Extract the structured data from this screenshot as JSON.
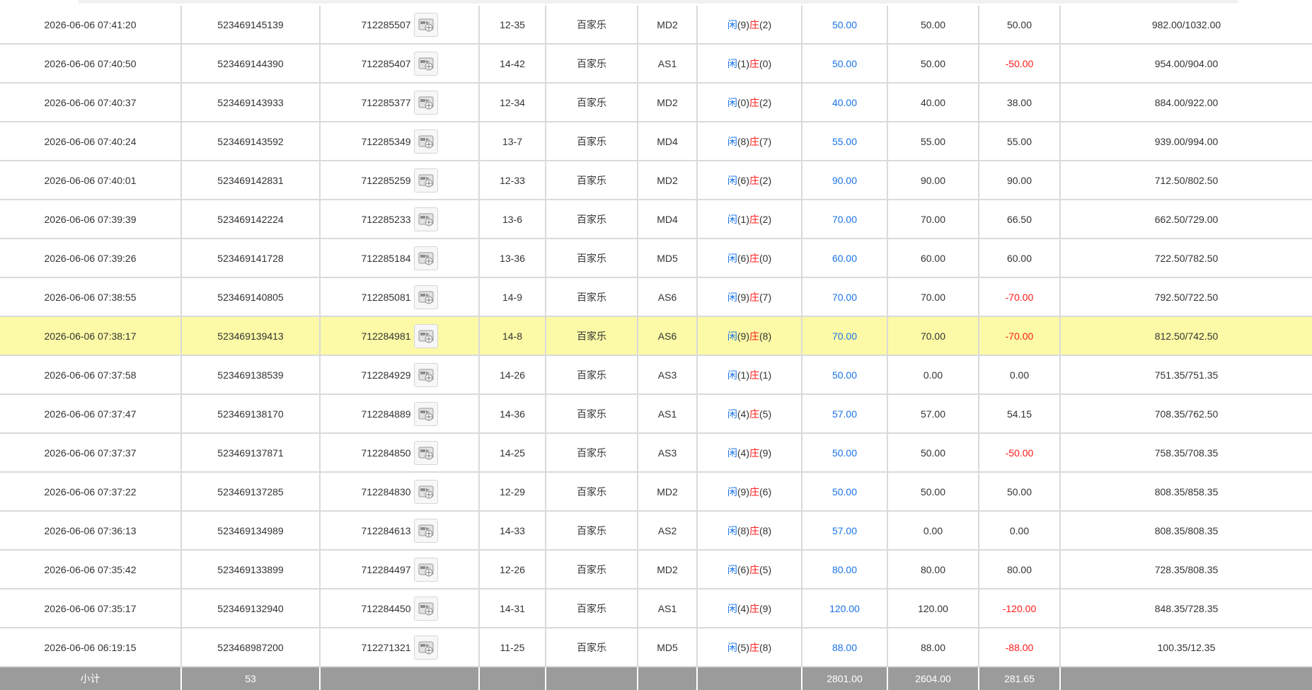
{
  "colors": {
    "blue": "#1a73e8",
    "red": "#ff1a1a",
    "highlight": "#fcfaa6",
    "subtotal_bg": "#9b9b9b"
  },
  "labels": {
    "player": "闲",
    "banker": "庄"
  },
  "rows": [
    {
      "time": "2026-06-06 07:41:20",
      "order": "523469145139",
      "game": "712285507",
      "shoe": "12-35",
      "type": "百家乐",
      "table": "MD2",
      "p": "9",
      "b": "2",
      "bet": "50.00",
      "valid": "50.00",
      "win": "50.00",
      "bal": "982.00/1032.00"
    },
    {
      "time": "2026-06-06 07:40:50",
      "order": "523469144390",
      "game": "712285407",
      "shoe": "14-42",
      "type": "百家乐",
      "table": "AS1",
      "p": "1",
      "b": "0",
      "bet": "50.00",
      "valid": "50.00",
      "win": "-50.00",
      "bal": "954.00/904.00"
    },
    {
      "time": "2026-06-06 07:40:37",
      "order": "523469143933",
      "game": "712285377",
      "shoe": "12-34",
      "type": "百家乐",
      "table": "MD2",
      "p": "0",
      "b": "2",
      "bet": "40.00",
      "valid": "40.00",
      "win": "38.00",
      "bal": "884.00/922.00"
    },
    {
      "time": "2026-06-06 07:40:24",
      "order": "523469143592",
      "game": "712285349",
      "shoe": "13-7",
      "type": "百家乐",
      "table": "MD4",
      "p": "8",
      "b": "7",
      "bet": "55.00",
      "valid": "55.00",
      "win": "55.00",
      "bal": "939.00/994.00"
    },
    {
      "time": "2026-06-06 07:40:01",
      "order": "523469142831",
      "game": "712285259",
      "shoe": "12-33",
      "type": "百家乐",
      "table": "MD2",
      "p": "6",
      "b": "2",
      "bet": "90.00",
      "valid": "90.00",
      "win": "90.00",
      "bal": "712.50/802.50"
    },
    {
      "time": "2026-06-06 07:39:39",
      "order": "523469142224",
      "game": "712285233",
      "shoe": "13-6",
      "type": "百家乐",
      "table": "MD4",
      "p": "1",
      "b": "2",
      "bet": "70.00",
      "valid": "70.00",
      "win": "66.50",
      "bal": "662.50/729.00"
    },
    {
      "time": "2026-06-06 07:39:26",
      "order": "523469141728",
      "game": "712285184",
      "shoe": "13-36",
      "type": "百家乐",
      "table": "MD5",
      "p": "6",
      "b": "0",
      "bet": "60.00",
      "valid": "60.00",
      "win": "60.00",
      "bal": "722.50/782.50"
    },
    {
      "time": "2026-06-06 07:38:55",
      "order": "523469140805",
      "game": "712285081",
      "shoe": "14-9",
      "type": "百家乐",
      "table": "AS6",
      "p": "9",
      "b": "7",
      "bet": "70.00",
      "valid": "70.00",
      "win": "-70.00",
      "bal": "792.50/722.50"
    },
    {
      "time": "2026-06-06 07:38:17",
      "order": "523469139413",
      "game": "712284981",
      "shoe": "14-8",
      "type": "百家乐",
      "table": "AS6",
      "p": "9",
      "b": "8",
      "bet": "70.00",
      "valid": "70.00",
      "win": "-70.00",
      "bal": "812.50/742.50",
      "highlight": true
    },
    {
      "time": "2026-06-06 07:37:58",
      "order": "523469138539",
      "game": "712284929",
      "shoe": "14-26",
      "type": "百家乐",
      "table": "AS3",
      "p": "1",
      "b": "1",
      "bet": "50.00",
      "valid": "0.00",
      "win": "0.00",
      "bal": "751.35/751.35"
    },
    {
      "time": "2026-06-06 07:37:47",
      "order": "523469138170",
      "game": "712284889",
      "shoe": "14-36",
      "type": "百家乐",
      "table": "AS1",
      "p": "4",
      "b": "5",
      "bet": "57.00",
      "valid": "57.00",
      "win": "54.15",
      "bal": "708.35/762.50"
    },
    {
      "time": "2026-06-06 07:37:37",
      "order": "523469137871",
      "game": "712284850",
      "shoe": "14-25",
      "type": "百家乐",
      "table": "AS3",
      "p": "4",
      "b": "9",
      "bet": "50.00",
      "valid": "50.00",
      "win": "-50.00",
      "bal": "758.35/708.35"
    },
    {
      "time": "2026-06-06 07:37:22",
      "order": "523469137285",
      "game": "712284830",
      "shoe": "12-29",
      "type": "百家乐",
      "table": "MD2",
      "p": "9",
      "b": "6",
      "bet": "50.00",
      "valid": "50.00",
      "win": "50.00",
      "bal": "808.35/858.35"
    },
    {
      "time": "2026-06-06 07:36:13",
      "order": "523469134989",
      "game": "712284613",
      "shoe": "14-33",
      "type": "百家乐",
      "table": "AS2",
      "p": "8",
      "b": "8",
      "bet": "57.00",
      "valid": "0.00",
      "win": "0.00",
      "bal": "808.35/808.35"
    },
    {
      "time": "2026-06-06 07:35:42",
      "order": "523469133899",
      "game": "712284497",
      "shoe": "12-26",
      "type": "百家乐",
      "table": "MD2",
      "p": "6",
      "b": "5",
      "bet": "80.00",
      "valid": "80.00",
      "win": "80.00",
      "bal": "728.35/808.35"
    },
    {
      "time": "2026-06-06 07:35:17",
      "order": "523469132940",
      "game": "712284450",
      "shoe": "14-31",
      "type": "百家乐",
      "table": "AS1",
      "p": "4",
      "b": "9",
      "bet": "120.00",
      "valid": "120.00",
      "win": "-120.00",
      "bal": "848.35/728.35"
    },
    {
      "time": "2026-06-06 06:19:15",
      "order": "523468987200",
      "game": "712271321",
      "shoe": "11-25",
      "type": "百家乐",
      "table": "MD5",
      "p": "5",
      "b": "8",
      "bet": "88.00",
      "valid": "88.00",
      "win": "-88.00",
      "bal": "100.35/12.35"
    }
  ],
  "subtotal": {
    "label": "小计",
    "count": "53",
    "bet": "2801.00",
    "valid": "2604.00",
    "win": "281.65"
  }
}
